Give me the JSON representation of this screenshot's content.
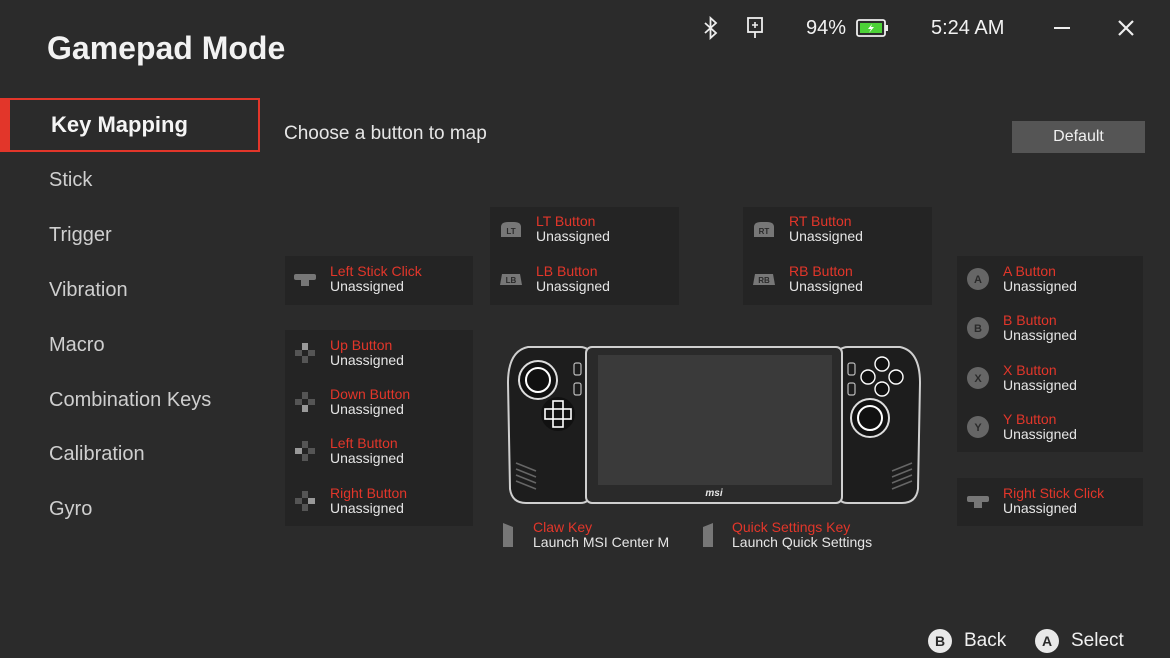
{
  "app": {
    "title": "Gamepad Mode"
  },
  "status": {
    "battery": "94%",
    "time": "5:24 AM"
  },
  "nav": {
    "items": [
      {
        "label": "Key Mapping"
      },
      {
        "label": "Stick"
      },
      {
        "label": "Trigger"
      },
      {
        "label": "Vibration"
      },
      {
        "label": "Macro"
      },
      {
        "label": "Combination Keys"
      },
      {
        "label": "Calibration"
      },
      {
        "label": "Gyro"
      }
    ]
  },
  "main": {
    "heading": "Choose a button to map",
    "default_label": "Default"
  },
  "buttons": {
    "lt": {
      "name": "LT Button",
      "value": "Unassigned"
    },
    "lb": {
      "name": "LB Button",
      "value": "Unassigned"
    },
    "rt": {
      "name": "RT Button",
      "value": "Unassigned"
    },
    "rb": {
      "name": "RB Button",
      "value": "Unassigned"
    },
    "left_stick": {
      "name": "Left Stick Click",
      "value": "Unassigned"
    },
    "up": {
      "name": "Up Button",
      "value": "Unassigned"
    },
    "down": {
      "name": "Down Button",
      "value": "Unassigned"
    },
    "left": {
      "name": "Left Button",
      "value": "Unassigned"
    },
    "right": {
      "name": "Right Button",
      "value": "Unassigned"
    },
    "a": {
      "name": "A Button",
      "value": "Unassigned"
    },
    "b": {
      "name": "B Button",
      "value": "Unassigned"
    },
    "x": {
      "name": "X Button",
      "value": "Unassigned"
    },
    "y": {
      "name": "Y Button",
      "value": "Unassigned"
    },
    "right_stick": {
      "name": "Right Stick Click",
      "value": "Unassigned"
    },
    "claw": {
      "name": "Claw Key",
      "value": "Launch MSI Center M"
    },
    "quick": {
      "name": "Quick Settings Key",
      "value": "Launch Quick Settings"
    }
  },
  "glyphs": {
    "lt": "LT",
    "lb": "LB",
    "rt": "RT",
    "rb": "RB",
    "a": "A",
    "b": "B",
    "x": "X",
    "y": "Y"
  },
  "device": {
    "brand": "msi"
  },
  "footer": {
    "back_glyph": "B",
    "back_label": "Back",
    "select_glyph": "A",
    "select_label": "Select"
  },
  "colors": {
    "accent": "#e2362a",
    "background": "#2b2b2b",
    "panel": "#242424"
  }
}
